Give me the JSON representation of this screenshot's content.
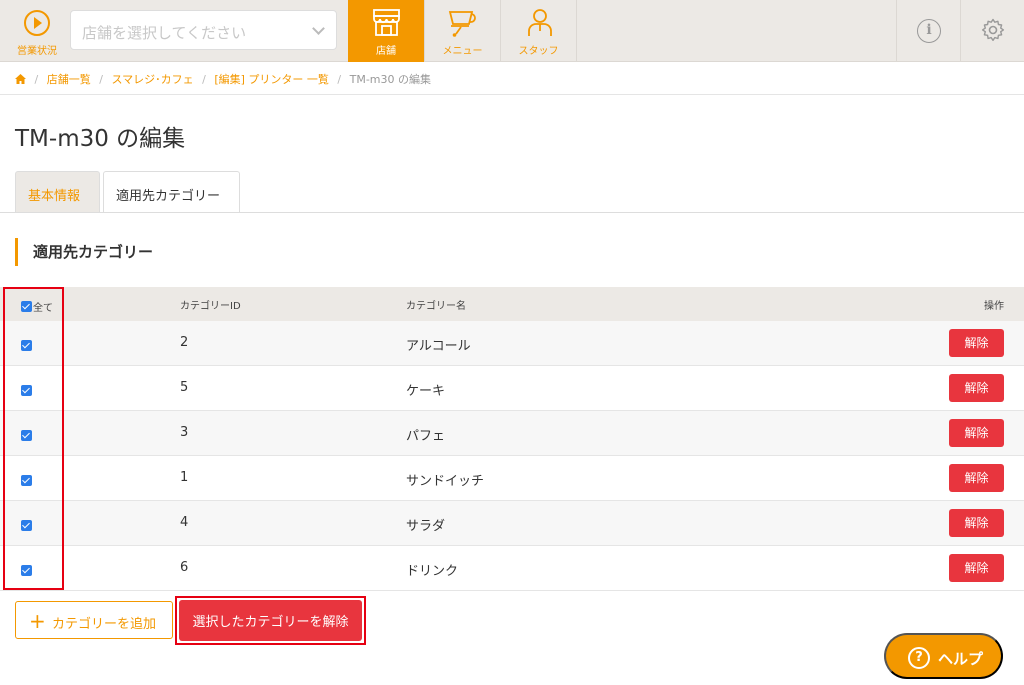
{
  "nav": {
    "status_label": "営業状況",
    "store_select_placeholder": "店舗を選択してください",
    "items": [
      {
        "label": "店舗",
        "icon": "store-icon",
        "active": true
      },
      {
        "label": "メニュー",
        "icon": "cup-icon",
        "active": false
      },
      {
        "label": "スタッフ",
        "icon": "staff-icon",
        "active": false
      }
    ],
    "info_icon": "info-icon",
    "gear_icon": "gear-icon"
  },
  "breadcrumb": {
    "items": [
      "店舗一覧",
      "スマレジ･カフェ",
      "[編集] プリンター 一覧"
    ],
    "current": "TM-m30 の編集"
  },
  "page_title": "TM-m30 の編集",
  "tabs": [
    {
      "label": "基本情報",
      "active": false
    },
    {
      "label": "適用先カテゴリー",
      "active": true
    }
  ],
  "section_title": "適用先カテゴリー",
  "table": {
    "headers": {
      "all": "全て",
      "id": "カテゴリーID",
      "name": "カテゴリー名",
      "op": "操作"
    },
    "rows": [
      {
        "id": "2",
        "name": "アルコール",
        "checked": true,
        "action": "解除"
      },
      {
        "id": "5",
        "name": "ケーキ",
        "checked": true,
        "action": "解除"
      },
      {
        "id": "3",
        "name": "パフェ",
        "checked": true,
        "action": "解除"
      },
      {
        "id": "1",
        "name": "サンドイッチ",
        "checked": true,
        "action": "解除"
      },
      {
        "id": "4",
        "name": "サラダ",
        "checked": true,
        "action": "解除"
      },
      {
        "id": "6",
        "name": "ドリンク",
        "checked": true,
        "action": "解除"
      }
    ]
  },
  "buttons": {
    "add_category": "カテゴリーを追加",
    "release_selected": "選択したカテゴリーを解除",
    "help": "ヘルプ"
  },
  "colors": {
    "accent": "#f39800",
    "danger": "#e8353e",
    "checkbox": "#2b7de9",
    "highlight": "#e60012"
  }
}
